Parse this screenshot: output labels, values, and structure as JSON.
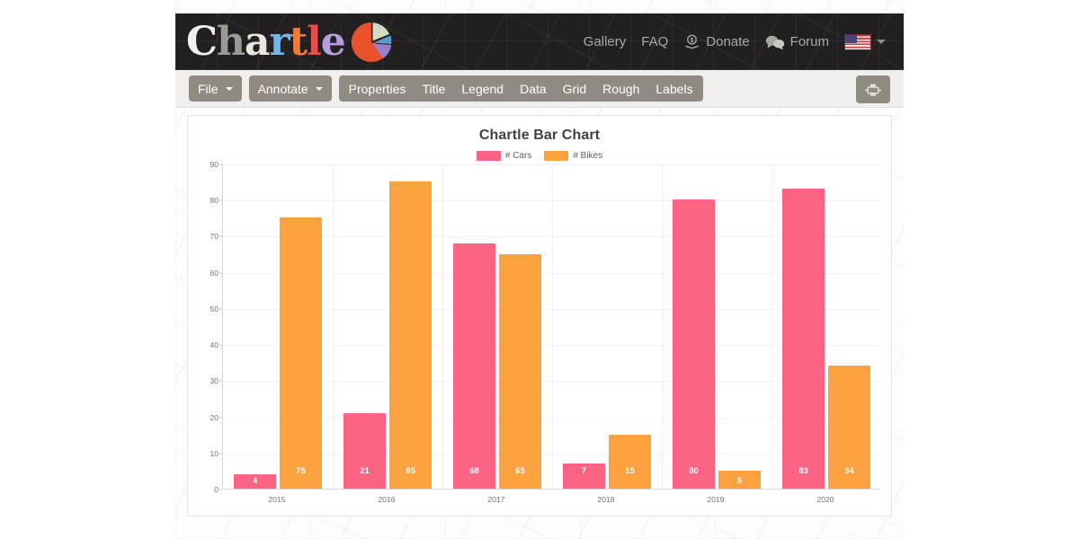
{
  "header": {
    "logo_text": "Chartle",
    "logo_letters": [
      "C",
      "h",
      "a",
      "r",
      "t",
      "l",
      "e"
    ],
    "logo_icon": "pie-chart-logo-icon",
    "nav": [
      {
        "label": "Gallery",
        "icon": null
      },
      {
        "label": "FAQ",
        "icon": null
      },
      {
        "label": "Donate",
        "icon": "donate-icon"
      },
      {
        "label": "Forum",
        "icon": "forum-icon"
      }
    ],
    "language": {
      "flag": "us-flag-icon",
      "caret": "chevron-down-icon"
    }
  },
  "toolbar": {
    "dropdowns": [
      {
        "label": "File"
      },
      {
        "label": "Annotate"
      }
    ],
    "menu_items": [
      {
        "label": "Properties"
      },
      {
        "label": "Title"
      },
      {
        "label": "Legend"
      },
      {
        "label": "Data"
      },
      {
        "label": "Grid"
      },
      {
        "label": "Rough"
      },
      {
        "label": "Labels"
      }
    ],
    "print_button": {
      "icon": "print-icon",
      "label": "Print"
    }
  },
  "colors": {
    "cars": "#fb6384",
    "bikes": "#fca13f",
    "header_bg": "#211f20",
    "toolbar_bg": "#f0efed",
    "button_bg": "#908b80",
    "axis_text": "#6d7278",
    "title_text": "#3f4246"
  },
  "chart_data": {
    "type": "bar",
    "title": "Chartle Bar Chart",
    "xlabel": "",
    "ylabel": "",
    "categories": [
      "2015",
      "2016",
      "2017",
      "2018",
      "2019",
      "2020"
    ],
    "series": [
      {
        "name": "# Cars",
        "color": "#fb6384",
        "values": [
          4,
          21,
          68,
          7,
          80,
          83
        ]
      },
      {
        "name": "# Bikes",
        "color": "#fca13f",
        "values": [
          75,
          85,
          65,
          15,
          5,
          34
        ]
      }
    ],
    "ylim": [
      0,
      90
    ],
    "yticks": [
      0,
      10,
      20,
      30,
      40,
      50,
      60,
      70,
      80,
      90
    ],
    "grid": true,
    "legend_position": "top",
    "data_labels": true
  }
}
